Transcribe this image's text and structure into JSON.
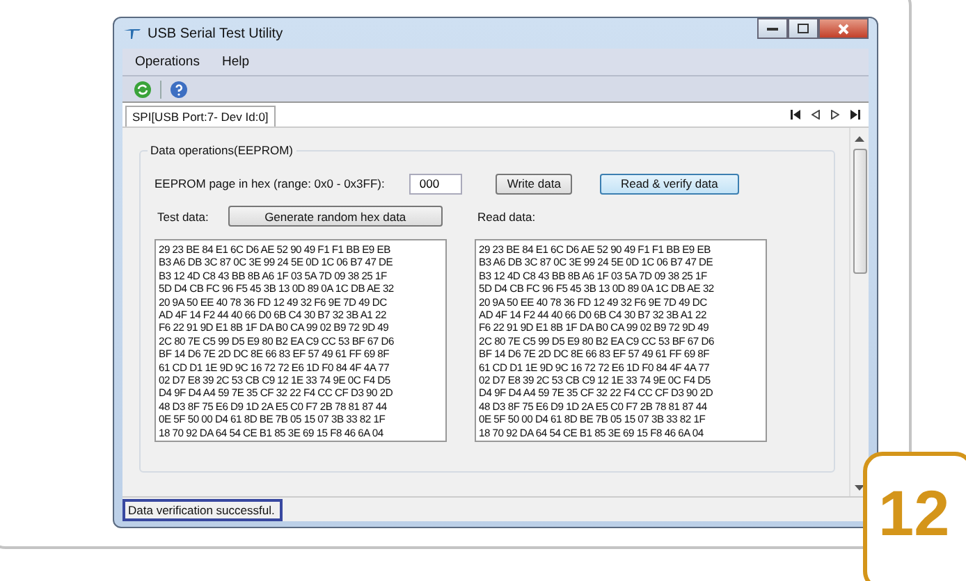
{
  "window": {
    "title": "USB Serial Test Utility"
  },
  "menu": [
    "Operations",
    "Help"
  ],
  "tabs": [
    {
      "label": "SPI[USB Port:7- Dev Id:0]",
      "selected": true
    }
  ],
  "group": {
    "title": "Data operations(EEPROM)",
    "page_label": "EEPROM page in hex (range: 0x0 - 0x3FF):",
    "page_value": "000",
    "buttons": [
      {
        "label": "Write data",
        "selected": false
      },
      {
        "label": "Read & verify data",
        "selected": true
      }
    ],
    "test_label": "Test data:",
    "generate_button": "Generate random hex data",
    "read_label": "Read data:",
    "test_data": [
      "29 23 BE 84 E1 6C D6 AE 52 90 49 F1 F1 BB E9 EB",
      "B3 A6 DB 3C 87 0C 3E 99 24 5E 0D 1C 06 B7 47 DE",
      "B3 12 4D C8 43 BB 8B A6 1F 03 5A 7D 09 38 25 1F",
      "5D D4 CB FC 96 F5 45 3B 13 0D 89 0A 1C DB AE 32",
      "20 9A 50 EE 40 78 36 FD 12 49 32 F6 9E 7D 49 DC",
      "AD 4F 14 F2 44 40 66 D0 6B C4 30 B7 32 3B A1 22",
      "F6 22 91 9D E1 8B 1F DA B0 CA 99 02 B9 72 9D 49",
      "2C 80 7E C5 99 D5 E9 80 B2 EA C9 CC 53 BF 67 D6",
      "BF 14 D6 7E 2D DC 8E 66 83 EF 57 49 61 FF 69 8F",
      "61 CD D1 1E 9D 9C 16 72 72 E6 1D F0 84 4F 4A 77",
      "02 D7 E8 39 2C 53 CB C9 12 1E 33 74 9E 0C F4 D5",
      "D4 9F D4 A4 59 7E 35 CF 32 22 F4 CC CF D3 90 2D",
      "48 D3 8F 75 E6 D9 1D 2A E5 C0 F7 2B 78 81 87 44",
      "0E 5F 50 00 D4 61 8D BE 7B 05 15 07 3B 33 82 1F",
      "18 70 92 DA 64 54 CE B1 85 3E 69 15 F8 46 6A 04"
    ],
    "read_data": [
      "29 23 BE 84 E1 6C D6 AE 52 90 49 F1 F1 BB E9 EB",
      "B3 A6 DB 3C 87 0C 3E 99 24 5E 0D 1C 06 B7 47 DE",
      "B3 12 4D C8 43 BB 8B A6 1F 03 5A 7D 09 38 25 1F",
      "5D D4 CB FC 96 F5 45 3B 13 0D 89 0A 1C DB AE 32",
      "20 9A 50 EE 40 78 36 FD 12 49 32 F6 9E 7D 49 DC",
      "AD 4F 14 F2 44 40 66 D0 6B C4 30 B7 32 3B A1 22",
      "F6 22 91 9D E1 8B 1F DA B0 CA 99 02 B9 72 9D 49",
      "2C 80 7E C5 99 D5 E9 80 B2 EA C9 CC 53 BF 67 D6",
      "BF 14 D6 7E 2D DC 8E 66 83 EF 57 49 61 FF 69 8F",
      "61 CD D1 1E 9D 9C 16 72 72 E6 1D F0 84 4F 4A 77",
      "02 D7 E8 39 2C 53 CB C9 12 1E 33 74 9E 0C F4 D5",
      "D4 9F D4 A4 59 7E 35 CF 32 22 F4 CC CF D3 90 2D",
      "48 D3 8F 75 E6 D9 1D 2A E5 C0 F7 2B 78 81 87 44",
      "0E 5F 50 00 D4 61 8D BE 7B 05 15 07 3B 33 82 1F",
      "18 70 92 DA 64 54 CE B1 85 3E 69 15 F8 46 6A 04"
    ]
  },
  "status_bar": "Data verification successful.",
  "badge": "12"
}
